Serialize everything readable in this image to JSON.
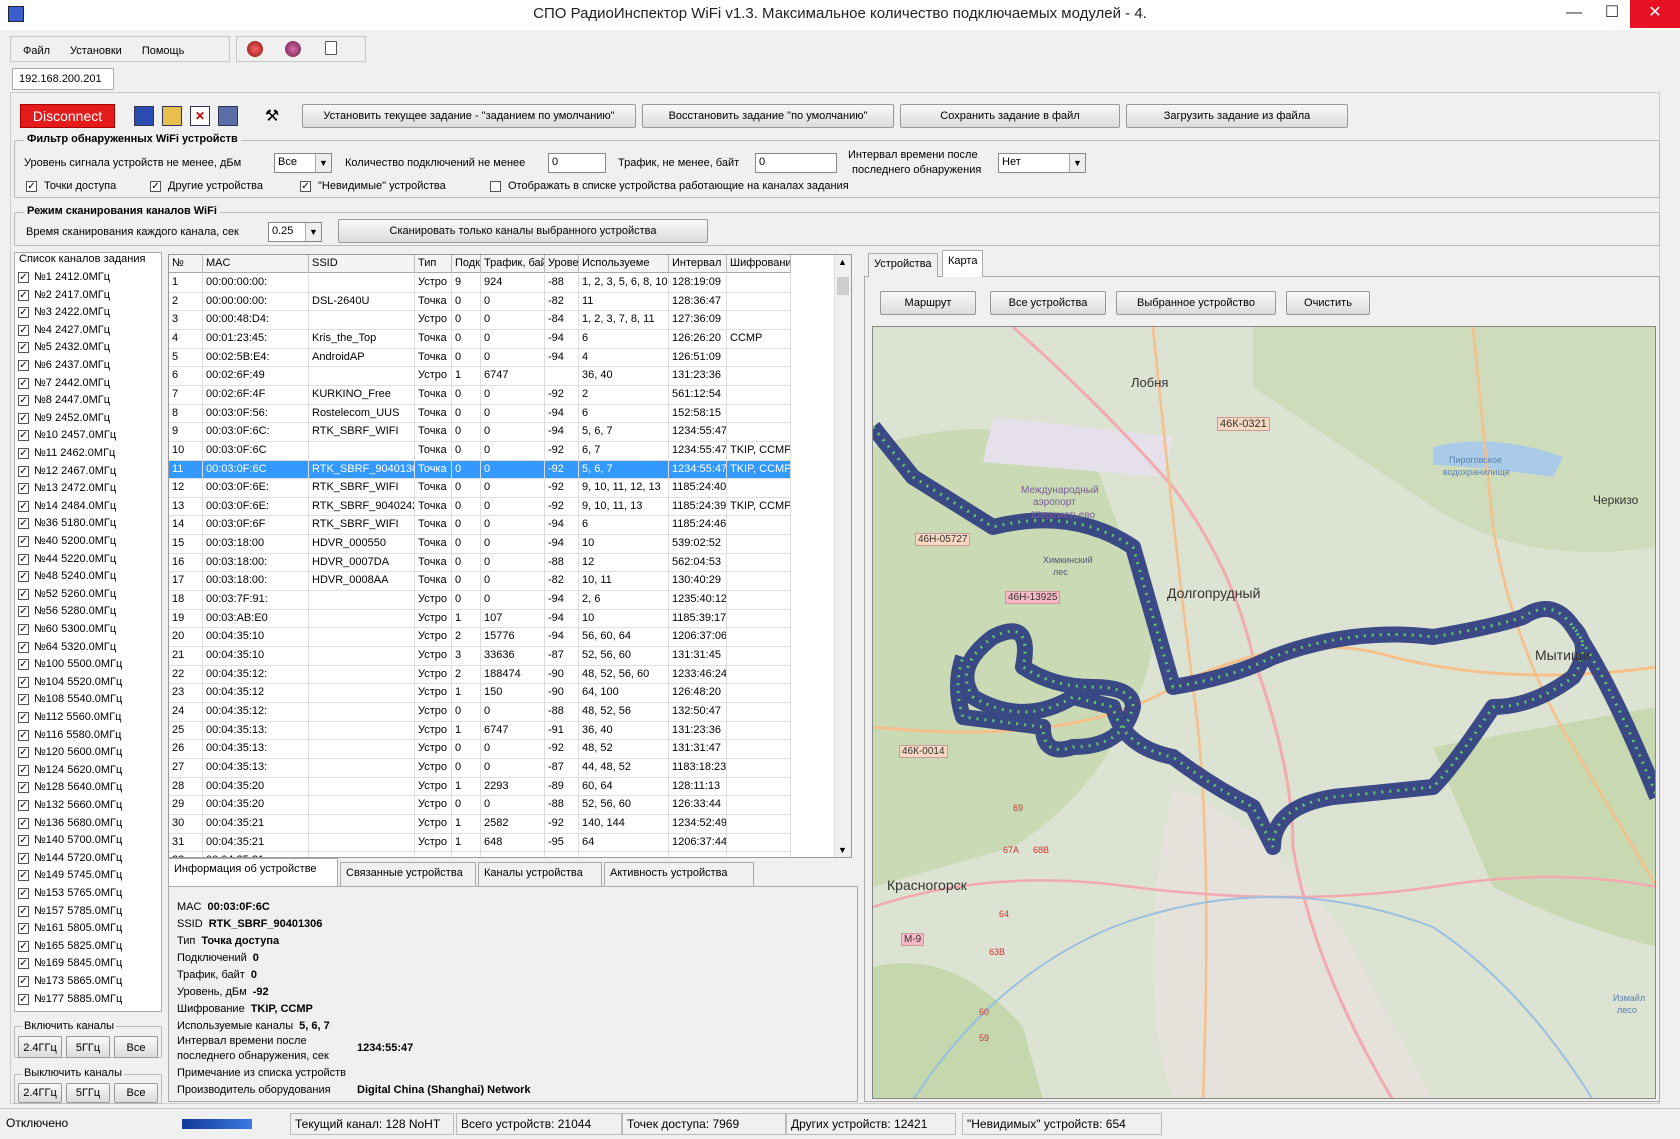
{
  "window": {
    "title": "СПО РадиоИнспектор WiFi v1.3. Максимальное количество подключаемых модулей - 4.",
    "min": "—",
    "max": "☐",
    "close": "✕"
  },
  "menu": {
    "file": "Файл",
    "settings": "Установки",
    "help": "Помощь"
  },
  "connection": {
    "ip": "192.168.200.201",
    "disconnect": "Disconnect"
  },
  "toolbar": {
    "set_default": "Установить текущее задание - \"заданием по умолчанию\"",
    "restore_default": "Восстановить задание \"по умолчанию\"",
    "save_file": "Сохранить задание в файл",
    "load_file": "Загрузить задание из файла"
  },
  "filter": {
    "title": "Фильтр обнаруженных WiFi устройств",
    "signal_label": "Уровень сигнала устройств не менее, дБм",
    "signal_value": "Все",
    "conn_label": "Количество подключений не менее",
    "conn_value": "0",
    "traffic_label": "Трафик, не менее, байт",
    "traffic_value": "0",
    "interval_label1": "Интервал времени после",
    "interval_label2": "последнего обнаружения",
    "interval_value": "Нет",
    "cb_ap": "Точки доступа",
    "cb_other": "Другие устройства",
    "cb_hidden": "\"Невидимые\" устройства",
    "cb_task": "Отображать в списке устройства работающие на каналах задания"
  },
  "scan": {
    "title": "Режим сканирования каналов WiFi",
    "time_label": "Время сканирования каждого канала, сек",
    "time_value": "0.25",
    "scan_btn": "Сканировать только каналы выбранного устройства"
  },
  "channels": {
    "title": "Список каналов задания",
    "items": [
      "№1   2412.0МГц",
      "№2   2417.0МГц",
      "№3   2422.0МГц",
      "№4   2427.0МГц",
      "№5   2432.0МГц",
      "№6   2437.0МГц",
      "№7   2442.0МГц",
      "№8   2447.0МГц",
      "№9   2452.0МГц",
      "№10   2457.0МГц",
      "№11   2462.0МГц",
      "№12   2467.0МГц",
      "№13   2472.0МГц",
      "№14   2484.0МГц",
      "№36   5180.0МГц",
      "№40   5200.0МГц",
      "№44   5220.0МГц",
      "№48   5240.0МГц",
      "№52   5260.0МГц",
      "№56   5280.0МГц",
      "№60   5300.0МГц",
      "№64   5320.0МГц",
      "№100   5500.0МГц",
      "№104   5520.0МГц",
      "№108   5540.0МГц",
      "№112   5560.0МГц",
      "№116   5580.0МГц",
      "№120   5600.0МГц",
      "№124   5620.0МГц",
      "№128   5640.0МГц",
      "№132   5660.0МГц",
      "№136   5680.0МГц",
      "№140   5700.0МГц",
      "№144   5720.0МГц",
      "№149   5745.0МГц",
      "№153   5765.0МГц",
      "№157   5785.0МГц",
      "№161   5805.0МГц",
      "№165   5825.0МГц",
      "№169   5845.0МГц",
      "№173   5865.0МГц",
      "№177   5885.0МГц"
    ],
    "enable_label": "Включить каналы",
    "disable_label": "Выключить каналы",
    "b24": "2.4ГГц",
    "b5": "5ГГц",
    "all": "Все"
  },
  "table": {
    "headers": [
      "№",
      "MAC",
      "SSID",
      "Тип",
      "Подк",
      "Трафик, байт",
      "Урове",
      "Используеме",
      "Интервал",
      "Шифровани"
    ],
    "rows": [
      [
        "1",
        "00:00:00:00:",
        "",
        "Устро",
        "9",
        "924",
        "-88",
        "1, 2, 3, 5, 6, 8, 10",
        "128:19:09",
        ""
      ],
      [
        "2",
        "00:00:00:00:",
        "DSL-2640U",
        "Точка",
        "0",
        "0",
        "-82",
        "11",
        "128:36:47",
        ""
      ],
      [
        "3",
        "00:00:48:D4:",
        "",
        "Устро",
        "0",
        "0",
        "-84",
        "1, 2, 3, 7, 8, 11",
        "127:36:09",
        ""
      ],
      [
        "4",
        "00:01:23:45:",
        "Kris_the_Top",
        "Точка",
        "0",
        "0",
        "-94",
        "6",
        "126:26:20",
        "CCMP"
      ],
      [
        "5",
        "00:02:5B:E4:",
        "AndroidAP",
        "Точка",
        "0",
        "0",
        "-94",
        "4",
        "126:51:09",
        ""
      ],
      [
        "6",
        "00:02:6F:49",
        "",
        "Устро",
        "1",
        "6747",
        "",
        "36, 40",
        "131:23:36",
        ""
      ],
      [
        "7",
        "00:02:6F:4F",
        "KURKINO_Free",
        "Точка",
        "0",
        "0",
        "-92",
        "2",
        "561:12:54",
        ""
      ],
      [
        "8",
        "00:03:0F:56:",
        "Rostelecom_UUS",
        "Точка",
        "0",
        "0",
        "-94",
        "6",
        "152:58:15",
        ""
      ],
      [
        "9",
        "00:03:0F:6C:",
        "RTK_SBRF_WIFI",
        "Точка",
        "0",
        "0",
        "-94",
        "5, 6, 7",
        "1234:55:47",
        ""
      ],
      [
        "10",
        "00:03:0F:6C",
        "",
        "Точка",
        "0",
        "0",
        "-92",
        "6, 7",
        "1234:55:47",
        "TKIP, CCMP"
      ],
      [
        "11",
        "00:03:0F:6C",
        "RTK_SBRF_90401306",
        "Точка",
        "0",
        "0",
        "-92",
        "5, 6, 7",
        "1234:55:47",
        "TKIP, CCMP"
      ],
      [
        "12",
        "00:03:0F:6E:",
        "RTK_SBRF_WIFI",
        "Точка",
        "0",
        "0",
        "-92",
        "9, 10, 11, 12, 13",
        "1185:24:40",
        ""
      ],
      [
        "13",
        "00:03:0F:6E:",
        "RTK_SBRF_90402427",
        "Точка",
        "0",
        "0",
        "-92",
        "9, 10, 11, 13",
        "1185:24:39",
        "TKIP, CCMP"
      ],
      [
        "14",
        "00:03:0F:6F",
        "RTK_SBRF_WIFI",
        "Точка",
        "0",
        "0",
        "-94",
        "6",
        "1185:24:46",
        ""
      ],
      [
        "15",
        "00:03:18:00",
        "HDVR_000550",
        "Точка",
        "0",
        "0",
        "-94",
        "10",
        "539:02:52",
        ""
      ],
      [
        "16",
        "00:03:18:00:",
        "HDVR_0007DA",
        "Точка",
        "0",
        "0",
        "-88",
        "12",
        "562:04:53",
        ""
      ],
      [
        "17",
        "00:03:18:00:",
        "HDVR_0008AA",
        "Точка",
        "0",
        "0",
        "-82",
        "10, 11",
        "130:40:29",
        ""
      ],
      [
        "18",
        "00:03:7F:91:",
        "",
        "Устро",
        "0",
        "0",
        "-94",
        "2, 6",
        "1235:40:12",
        ""
      ],
      [
        "19",
        "00:03:AB:E0",
        "",
        "Устро",
        "1",
        "107",
        "-94",
        "10",
        "1185:39:17",
        ""
      ],
      [
        "20",
        "00:04:35:10",
        "",
        "Устро",
        "2",
        "15776",
        "-94",
        "56, 60, 64",
        "1206:37:06",
        ""
      ],
      [
        "21",
        "00:04:35:10",
        "",
        "Устро",
        "3",
        "33636",
        "-87",
        "52, 56, 60",
        "131:31:45",
        ""
      ],
      [
        "22",
        "00:04:35:12:",
        "",
        "Устро",
        "2",
        "188474",
        "-90",
        "48, 52, 56, 60",
        "1233:46:24",
        ""
      ],
      [
        "23",
        "00:04:35:12",
        "",
        "Устро",
        "1",
        "150",
        "-90",
        "64, 100",
        "126:48:20",
        ""
      ],
      [
        "24",
        "00:04:35:12:",
        "",
        "Устро",
        "0",
        "0",
        "-88",
        "48, 52, 56",
        "132:50:47",
        ""
      ],
      [
        "25",
        "00:04:35:13:",
        "",
        "Устро",
        "1",
        "6747",
        "-91",
        "36, 40",
        "131:23:36",
        ""
      ],
      [
        "26",
        "00:04:35:13:",
        "",
        "Устро",
        "0",
        "0",
        "-92",
        "48, 52",
        "131:31:47",
        ""
      ],
      [
        "27",
        "00:04:35:13:",
        "",
        "Устро",
        "0",
        "0",
        "-87",
        "44, 48, 52",
        "1183:18:23",
        ""
      ],
      [
        "28",
        "00:04:35:20",
        "",
        "Устро",
        "1",
        "2293",
        "-89",
        "60, 64",
        "128:11:13",
        ""
      ],
      [
        "29",
        "00:04:35:20",
        "",
        "Устро",
        "0",
        "0",
        "-88",
        "52, 56, 60",
        "126:33:44",
        ""
      ],
      [
        "30",
        "00:04:35:21",
        "",
        "Устро",
        "1",
        "2582",
        "-92",
        "140, 144",
        "1234:52:49",
        ""
      ],
      [
        "31",
        "00:04:35:21",
        "",
        "Устро",
        "1",
        "648",
        "-95",
        "64",
        "1206:37:44",
        ""
      ],
      [
        "32",
        "00:04:35:21",
        "",
        "",
        "",
        "",
        "",
        "",
        "",
        ""
      ]
    ]
  },
  "bottom_tabs": [
    "Информация об устройстве",
    "Связанные устройства",
    "Каналы устройства",
    "Активность устройства"
  ],
  "info": {
    "mac_l": "MAC",
    "mac": "00:03:0F:6C",
    "ssid_l": "SSID",
    "ssid": "RTK_SBRF_90401306",
    "type_l": "Тип",
    "type": "Точка доступа",
    "conn_l": "Подключений",
    "conn": "0",
    "traffic_l": "Трафик, байт",
    "traffic": "0",
    "level_l": "Уровень, дБм",
    "level": "-92",
    "enc_l": "Шифрование",
    "enc": "TKIP, CCMP",
    "ch_l": "Используемые каналы",
    "ch": "5, 6, 7",
    "int_l1": "Интервал времени после",
    "int_l2": "последнего обнаружения, сек",
    "int": "1234:55:47",
    "note_l": "Примечание из списка устройств",
    "vendor_l": "Производитель оборудования",
    "vendor": "Digital China (Shanghai) Network"
  },
  "right_tabs": {
    "devices": "Устройства",
    "map": "Карта"
  },
  "map_btns": {
    "route": "Маршрут",
    "all": "Все устройства",
    "selected": "Выбранное устройство",
    "clear": "Очистить"
  },
  "map_labels": {
    "lobnya": "Лобня",
    "k321": "46К-0321",
    "airport1": "Международный",
    "airport2": "аэропорт",
    "airport3": "Шереметьево",
    "reservoir1": "Пироговское",
    "reservoir2": "водохранилище",
    "cherkizovo": "Черкизо",
    "k46": "46Н-05727",
    "h13925": "46Н-13925",
    "forest1": "Химкинский",
    "forest2": "лес",
    "dolgoprudny": "Долгопрудный",
    "mytishchi": "Мытищи",
    "k0014": "46К-0014",
    "krasnogorsk": "Красногорск",
    "m9": "М-9",
    "r69": "69",
    "r67": "67А",
    "r68": "68В",
    "r64": "64",
    "r63": "63В",
    "r59": "59",
    "r60": "60",
    "izmailovo1": "Измайл",
    "izmailovo2": "лесо"
  },
  "status": {
    "state": "Отключено",
    "channel": "Текущий канал: 128 NoHT",
    "total": "Всего устройств: 21044",
    "ap": "Точек доступа: 7969",
    "other": "Других устройств: 12421",
    "hidden": "\"Невидимых\" устройств: 654"
  }
}
